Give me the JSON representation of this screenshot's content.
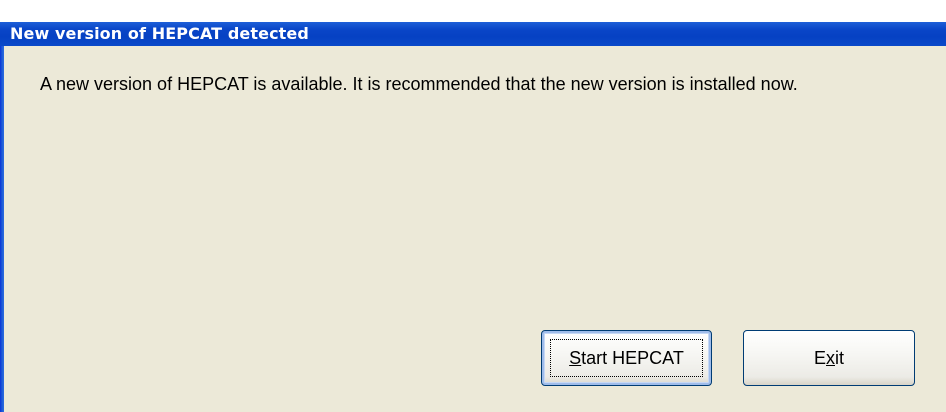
{
  "window": {
    "title": "New version of HEPCAT detected"
  },
  "dialog": {
    "message": "A new version of HEPCAT is available. It is recommended that the new version is installed now."
  },
  "buttons": {
    "start_hepcat": {
      "label": "Start HEPCAT",
      "accelerator": "S"
    },
    "exit": {
      "label": "Exit",
      "accelerator": "x"
    }
  },
  "colors": {
    "titlebar": "#0a46c8",
    "dialog_background": "#ece9d8",
    "button_border": "#003c74"
  }
}
